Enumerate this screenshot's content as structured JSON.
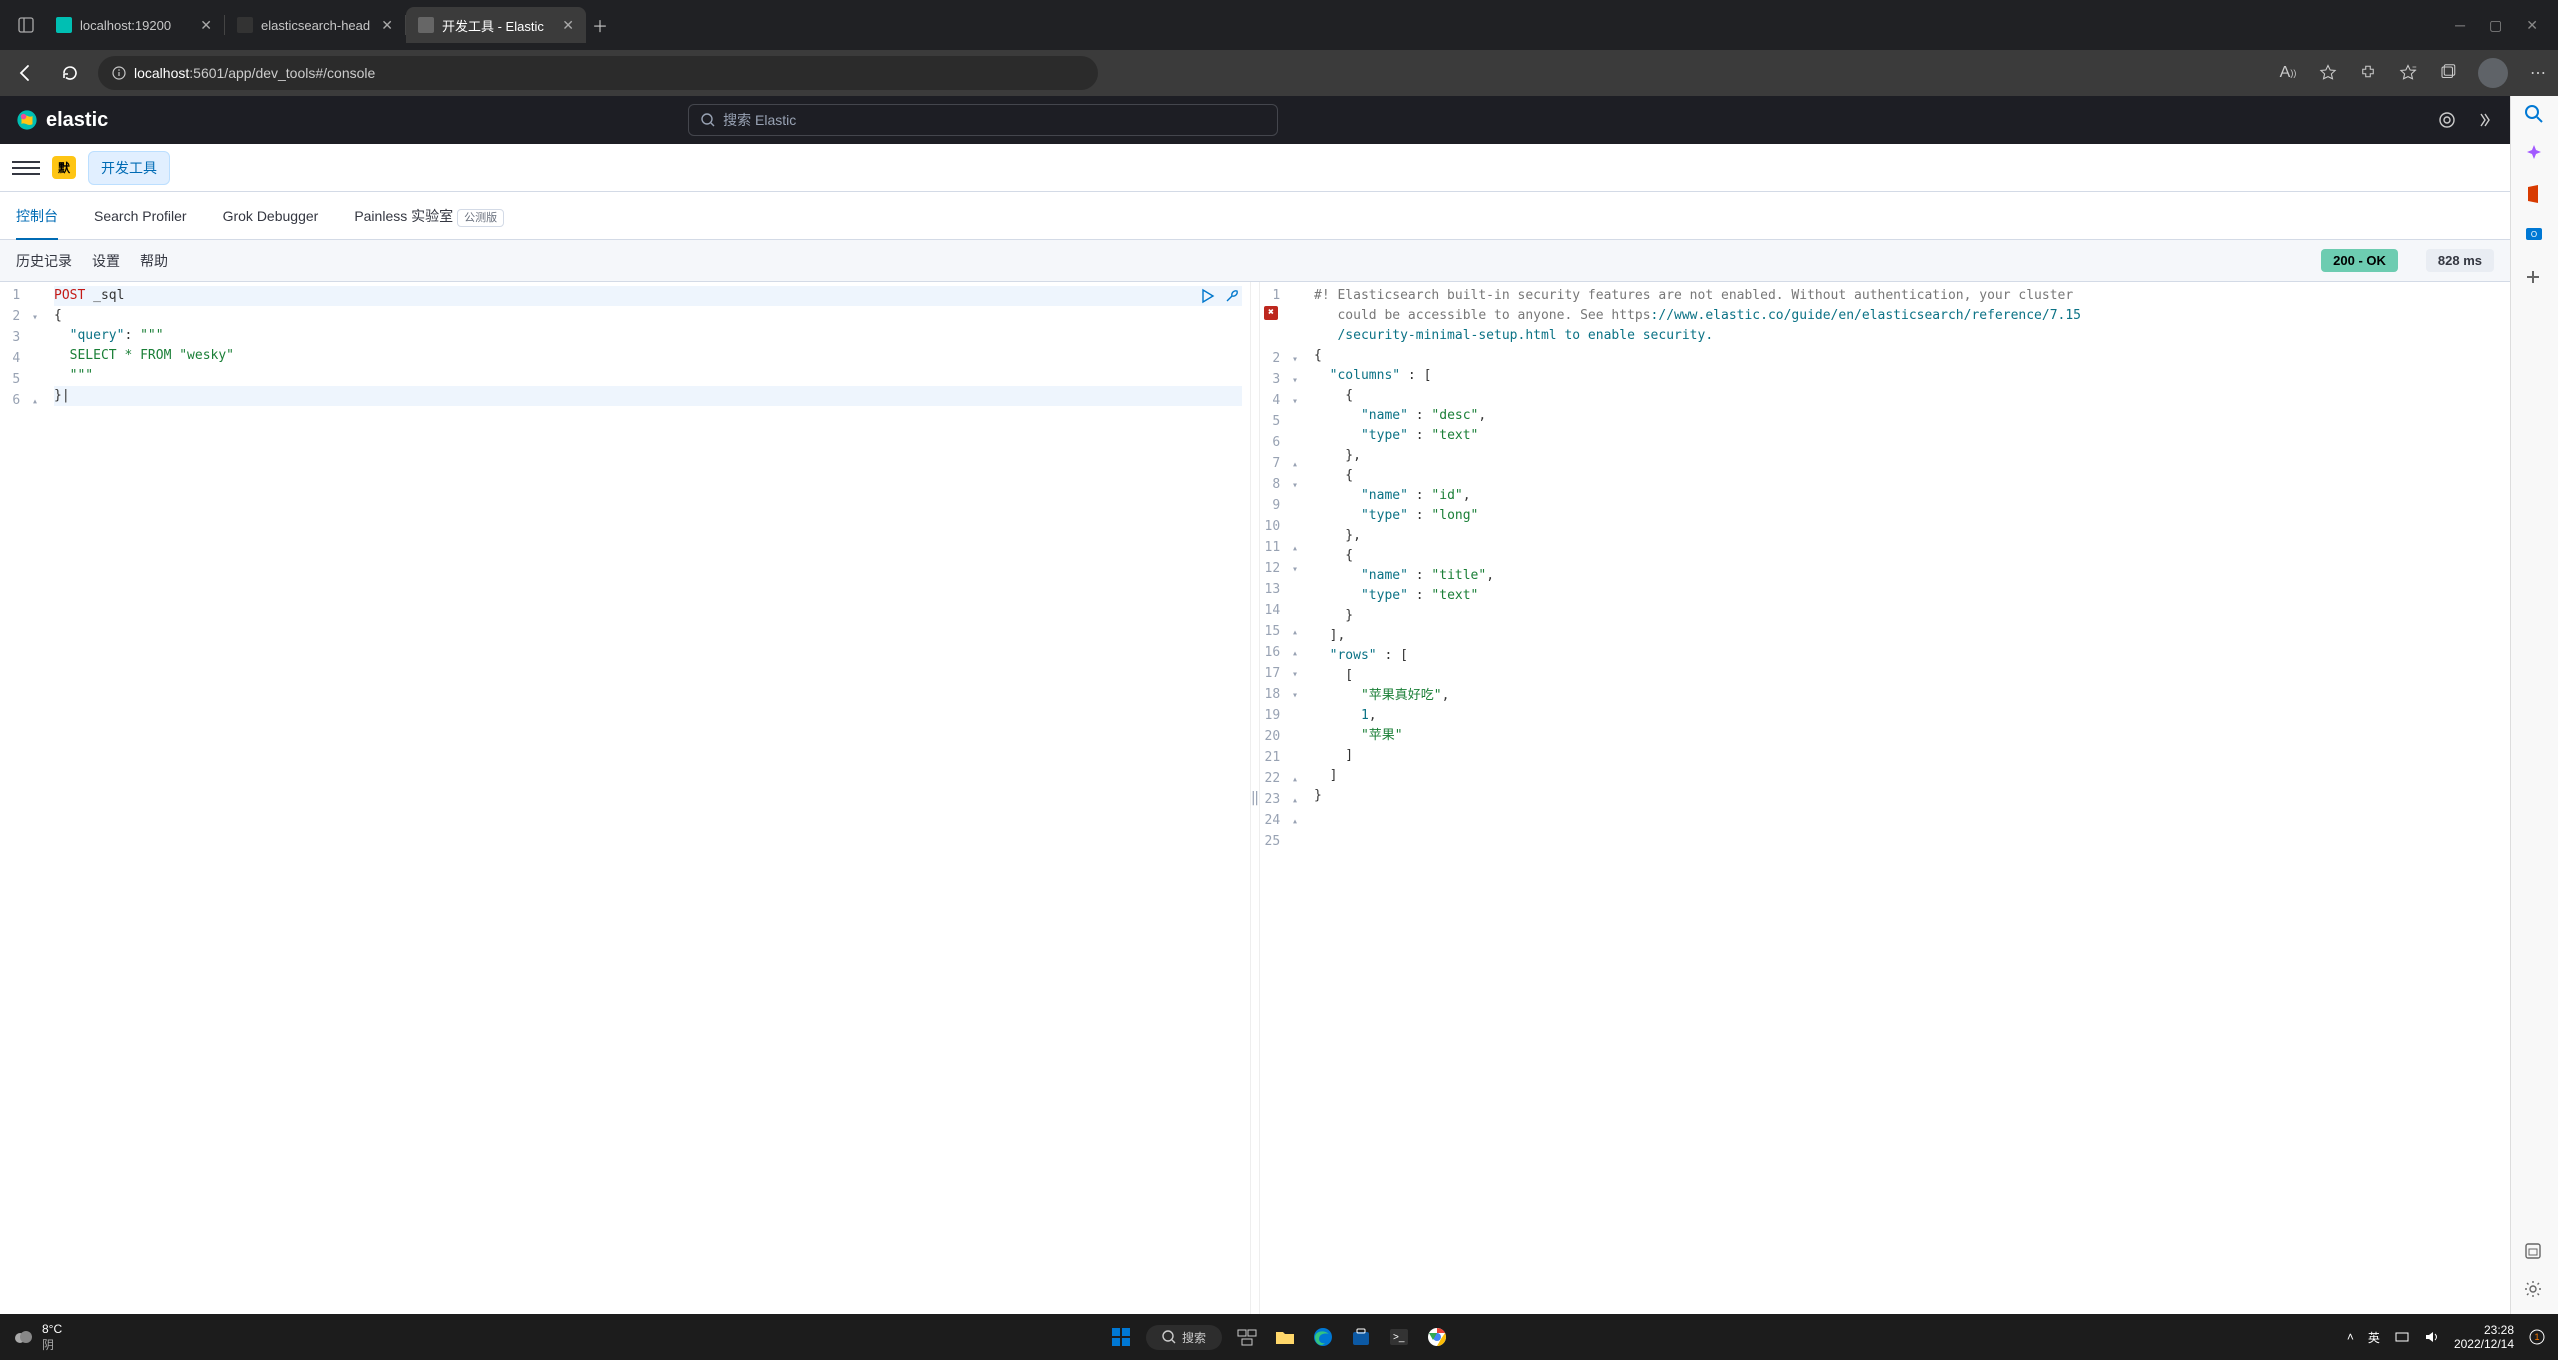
{
  "browser": {
    "tabs": [
      {
        "label": "localhost:19200",
        "active": false
      },
      {
        "label": "elasticsearch-head",
        "active": false
      },
      {
        "label": "开发工具 - Elastic",
        "active": true
      }
    ],
    "url_host": "localhost",
    "url_path": ":5601/app/dev_tools#/console"
  },
  "kibana": {
    "brand": "elastic",
    "search_placeholder": "搜索 Elastic",
    "badge_default": "默",
    "dev_tools_label": "开发工具",
    "tabs": [
      {
        "label": "控制台",
        "active": true
      },
      {
        "label": "Search Profiler",
        "active": false
      },
      {
        "label": "Grok Debugger",
        "active": false
      },
      {
        "label": "Painless 实验室",
        "active": false,
        "beta": "公测版"
      }
    ],
    "toolbar": {
      "history": "历史记录",
      "settings": "设置",
      "help": "帮助"
    },
    "status_ok": "200 - OK",
    "status_time": "828 ms"
  },
  "request": {
    "lines": [
      {
        "n": 1,
        "fold": "",
        "content": [
          {
            "t": "POST",
            "c": "method"
          },
          {
            "t": " _sql",
            "c": ""
          }
        ]
      },
      {
        "n": 2,
        "fold": "▾",
        "content": [
          {
            "t": "{",
            "c": ""
          }
        ]
      },
      {
        "n": 3,
        "fold": "",
        "content": [
          {
            "t": "  ",
            "c": ""
          },
          {
            "t": "\"query\"",
            "c": "key"
          },
          {
            "t": ": ",
            "c": ""
          },
          {
            "t": "\"\"\"",
            "c": "str"
          }
        ]
      },
      {
        "n": 4,
        "fold": "",
        "content": [
          {
            "t": "  SELECT * FROM \"wesky\"",
            "c": "str"
          }
        ]
      },
      {
        "n": 5,
        "fold": "",
        "content": [
          {
            "t": "  ",
            "c": ""
          },
          {
            "t": "\"\"\"",
            "c": "str"
          }
        ]
      },
      {
        "n": 6,
        "fold": "▴",
        "content": [
          {
            "t": "}|",
            "c": ""
          }
        ],
        "hl": true
      }
    ]
  },
  "response": {
    "lines": [
      {
        "n": 1,
        "fold": "",
        "content": [
          {
            "t": "#! Elasticsearch built-in security features are not enabled. Without authentication, your cluster",
            "c": "comment"
          }
        ]
      },
      {
        "n": "",
        "fold": "",
        "content": [
          {
            "t": "   could be accessible to anyone. See https",
            "c": "comment"
          },
          {
            "t": "://www.elastic.co/guide/en/elasticsearch/reference/7.15",
            "c": "link"
          }
        ],
        "err": true
      },
      {
        "n": "",
        "fold": "",
        "content": [
          {
            "t": "   /security-minimal-setup.html to enable security.",
            "c": "link"
          }
        ]
      },
      {
        "n": 2,
        "fold": "▾",
        "content": [
          {
            "t": "{",
            "c": ""
          }
        ]
      },
      {
        "n": 3,
        "fold": "▾",
        "content": [
          {
            "t": "  ",
            "c": ""
          },
          {
            "t": "\"columns\"",
            "c": "key"
          },
          {
            "t": " : [",
            "c": ""
          }
        ]
      },
      {
        "n": 4,
        "fold": "▾",
        "content": [
          {
            "t": "    {",
            "c": ""
          }
        ]
      },
      {
        "n": 5,
        "fold": "",
        "content": [
          {
            "t": "      ",
            "c": ""
          },
          {
            "t": "\"name\"",
            "c": "key"
          },
          {
            "t": " : ",
            "c": ""
          },
          {
            "t": "\"desc\"",
            "c": "str"
          },
          {
            "t": ",",
            "c": ""
          }
        ]
      },
      {
        "n": 6,
        "fold": "",
        "content": [
          {
            "t": "      ",
            "c": ""
          },
          {
            "t": "\"type\"",
            "c": "key"
          },
          {
            "t": " : ",
            "c": ""
          },
          {
            "t": "\"text\"",
            "c": "str"
          }
        ]
      },
      {
        "n": 7,
        "fold": "▴",
        "content": [
          {
            "t": "    },",
            "c": ""
          }
        ]
      },
      {
        "n": 8,
        "fold": "▾",
        "content": [
          {
            "t": "    {",
            "c": ""
          }
        ]
      },
      {
        "n": 9,
        "fold": "",
        "content": [
          {
            "t": "      ",
            "c": ""
          },
          {
            "t": "\"name\"",
            "c": "key"
          },
          {
            "t": " : ",
            "c": ""
          },
          {
            "t": "\"id\"",
            "c": "str"
          },
          {
            "t": ",",
            "c": ""
          }
        ]
      },
      {
        "n": 10,
        "fold": "",
        "content": [
          {
            "t": "      ",
            "c": ""
          },
          {
            "t": "\"type\"",
            "c": "key"
          },
          {
            "t": " : ",
            "c": ""
          },
          {
            "t": "\"long\"",
            "c": "str"
          }
        ]
      },
      {
        "n": 11,
        "fold": "▴",
        "content": [
          {
            "t": "    },",
            "c": ""
          }
        ]
      },
      {
        "n": 12,
        "fold": "▾",
        "content": [
          {
            "t": "    {",
            "c": ""
          }
        ]
      },
      {
        "n": 13,
        "fold": "",
        "content": [
          {
            "t": "      ",
            "c": ""
          },
          {
            "t": "\"name\"",
            "c": "key"
          },
          {
            "t": " : ",
            "c": ""
          },
          {
            "t": "\"title\"",
            "c": "str"
          },
          {
            "t": ",",
            "c": ""
          }
        ]
      },
      {
        "n": 14,
        "fold": "",
        "content": [
          {
            "t": "      ",
            "c": ""
          },
          {
            "t": "\"type\"",
            "c": "key"
          },
          {
            "t": " : ",
            "c": ""
          },
          {
            "t": "\"text\"",
            "c": "str"
          }
        ]
      },
      {
        "n": 15,
        "fold": "▴",
        "content": [
          {
            "t": "    }",
            "c": ""
          }
        ]
      },
      {
        "n": 16,
        "fold": "▴",
        "content": [
          {
            "t": "  ],",
            "c": ""
          }
        ]
      },
      {
        "n": 17,
        "fold": "▾",
        "content": [
          {
            "t": "  ",
            "c": ""
          },
          {
            "t": "\"rows\"",
            "c": "key"
          },
          {
            "t": " : [",
            "c": ""
          }
        ]
      },
      {
        "n": 18,
        "fold": "▾",
        "content": [
          {
            "t": "    [",
            "c": ""
          }
        ]
      },
      {
        "n": 19,
        "fold": "",
        "content": [
          {
            "t": "      ",
            "c": ""
          },
          {
            "t": "\"苹果真好吃\"",
            "c": "str"
          },
          {
            "t": ",",
            "c": ""
          }
        ]
      },
      {
        "n": 20,
        "fold": "",
        "content": [
          {
            "t": "      ",
            "c": ""
          },
          {
            "t": "1",
            "c": "num"
          },
          {
            "t": ",",
            "c": ""
          }
        ]
      },
      {
        "n": 21,
        "fold": "",
        "content": [
          {
            "t": "      ",
            "c": ""
          },
          {
            "t": "\"苹果\"",
            "c": "str"
          }
        ]
      },
      {
        "n": 22,
        "fold": "▴",
        "content": [
          {
            "t": "    ]",
            "c": ""
          }
        ]
      },
      {
        "n": 23,
        "fold": "▴",
        "content": [
          {
            "t": "  ]",
            "c": ""
          }
        ]
      },
      {
        "n": 24,
        "fold": "▴",
        "content": [
          {
            "t": "}",
            "c": ""
          }
        ]
      },
      {
        "n": 25,
        "fold": "",
        "content": [
          {
            "t": "",
            "c": ""
          }
        ]
      }
    ]
  },
  "taskbar": {
    "weather_temp": "8°C",
    "weather_cond": "阴",
    "search_label": "搜索",
    "ime": "英",
    "time": "23:28",
    "date": "2022/12/14"
  }
}
